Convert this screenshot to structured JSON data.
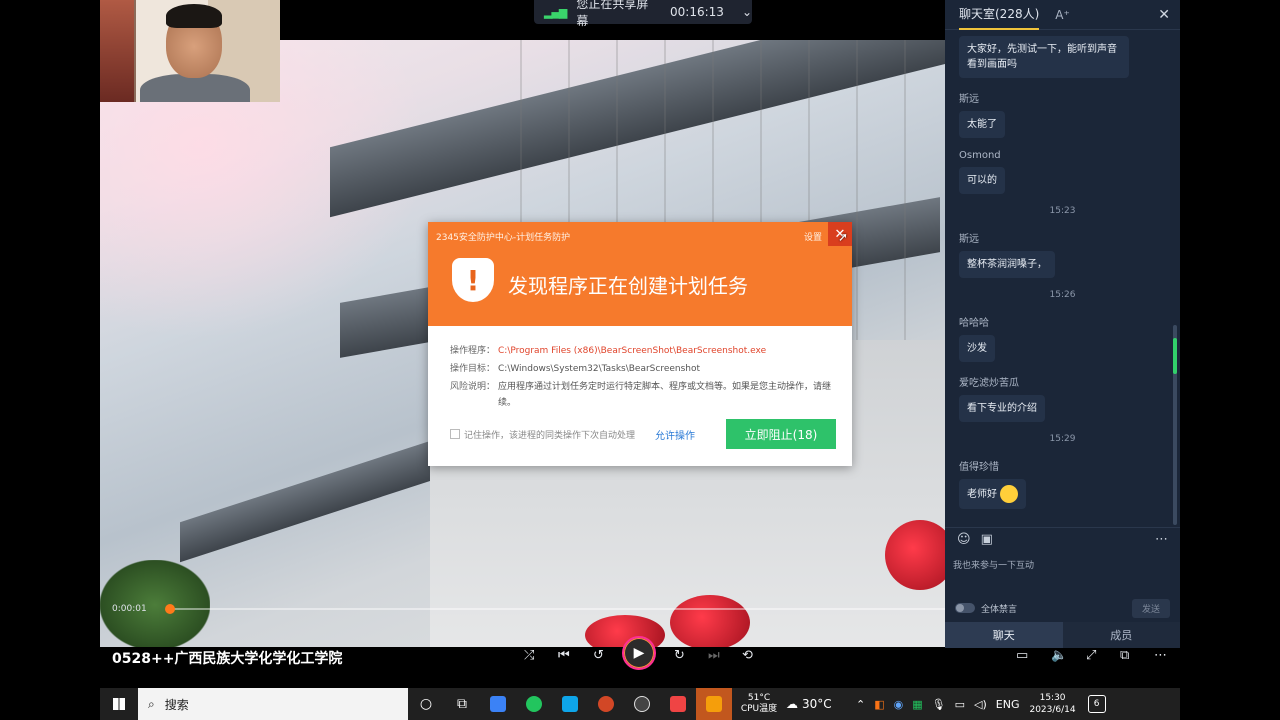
{
  "share_bar": {
    "status": "您正在共享屏幕",
    "elapsed": "00:16:13"
  },
  "chat": {
    "title": "聊天室(228人)",
    "font_button": "A⁺",
    "messages": [
      {
        "type": "msg",
        "name": "",
        "text": "大家好，先测试一下，能听到声音看到画面吗"
      },
      {
        "type": "msg",
        "name": "斯远",
        "text": "太能了"
      },
      {
        "type": "msg",
        "name": "Osmond",
        "text": "可以的"
      },
      {
        "type": "time",
        "text": "15:23"
      },
      {
        "type": "msg",
        "name": "斯远",
        "text": "整杯茶润润嗓子，"
      },
      {
        "type": "time",
        "text": "15:26"
      },
      {
        "type": "msg",
        "name": "哈哈哈",
        "text": "沙发"
      },
      {
        "type": "msg",
        "name": "爱吃滤炒苦瓜",
        "text": "看下专业的介绍"
      },
      {
        "type": "time",
        "text": "15:29"
      },
      {
        "type": "msg",
        "name": "值得珍惜",
        "text": "老师好",
        "emoji": true
      }
    ],
    "input_placeholder": "我也来参与一下互动",
    "mute_all_label": "全体禁言",
    "send_label": "发送",
    "tabs": {
      "chat": "聊天",
      "members": "成员"
    }
  },
  "dialog": {
    "title": "2345安全防护中心-计划任务防护",
    "settings_label": "设置",
    "heading": "发现程序正在创建计划任务",
    "rows": [
      {
        "key": "操作程序：",
        "value": "C:\\Program Files (x86)\\BearScreenShot\\BearScreenshot.exe"
      },
      {
        "key": "操作目标：",
        "value": "C:\\Windows\\System32\\Tasks\\BearScreenshot"
      },
      {
        "key": "风险说明：",
        "value": "应用程序通过计划任务定时运行特定脚本、程序或文档等。如果是您主动操作，请继续。"
      }
    ],
    "remember_label": "记住操作，该进程的同类操作下次自动处理",
    "allow_label": "允许操作",
    "block_label": "立即阻止(18)"
  },
  "player": {
    "current_time": "0:00:01",
    "progress_fraction": 0.0,
    "course_title": "0528++广西民族大学化学化工学院"
  },
  "taskbar": {
    "search_label": "搜索",
    "cpu_temp": "51°C",
    "cpu_label": "CPU温度",
    "weather_temp": "30°C",
    "lang": "ENG",
    "time": "15:30",
    "date": "2023/6/14",
    "notif_count": "6"
  },
  "colors": {
    "dialog_header": "#f67a2c",
    "block_button": "#2ec26a",
    "chat_bg": "#1b2638",
    "progress_dot": "#ff7a1a"
  }
}
